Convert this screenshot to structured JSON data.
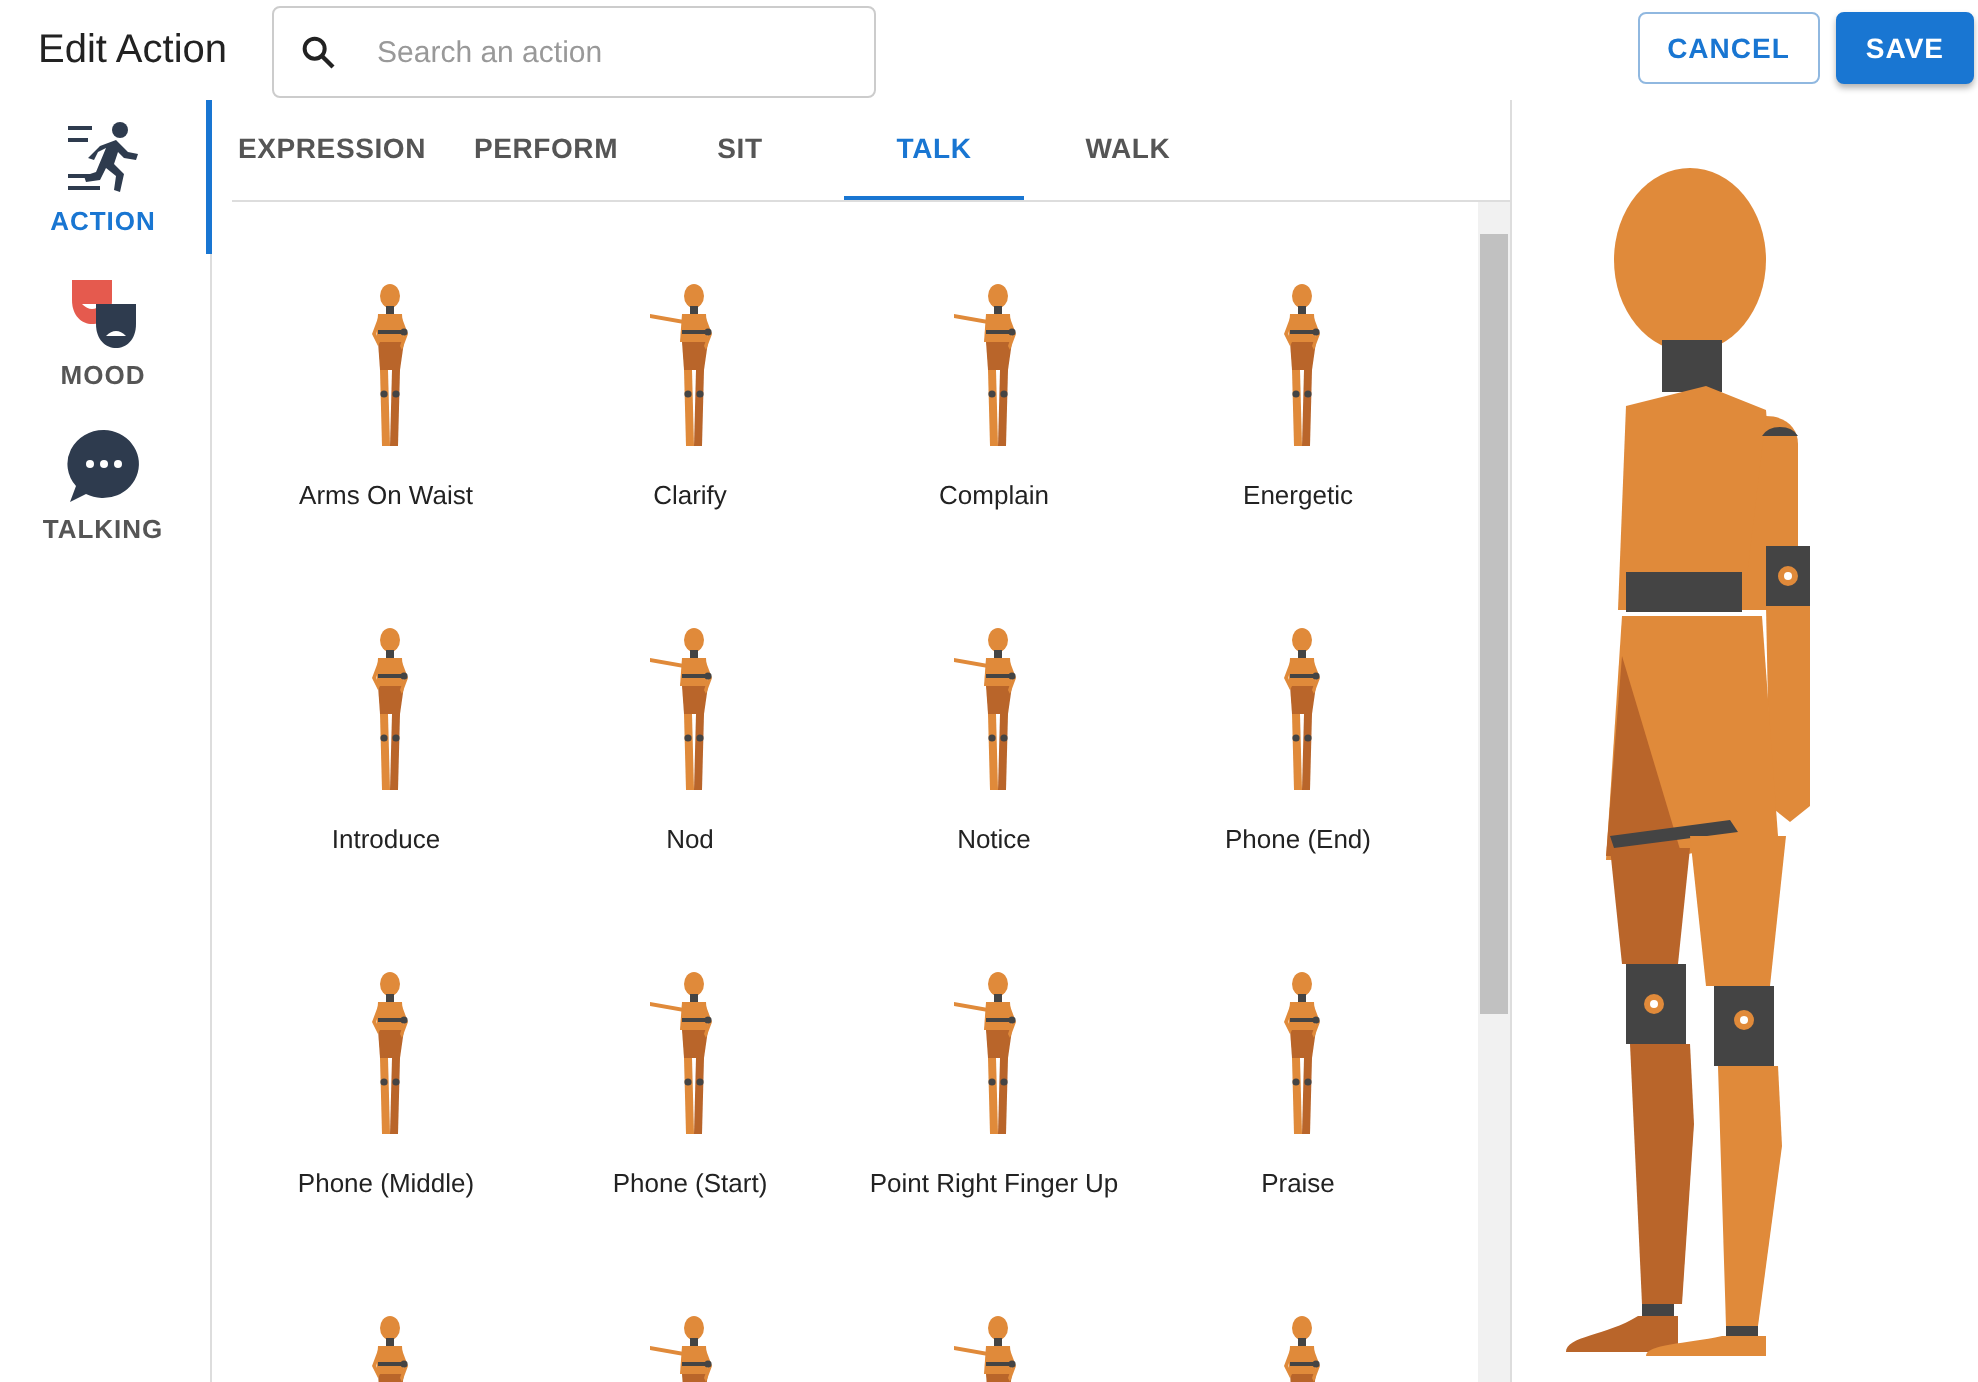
{
  "header": {
    "title": "Edit Action",
    "search": {
      "placeholder": "Search an action"
    },
    "buttons": [
      {
        "label": "CANCEL",
        "kind": "outlined"
      },
      {
        "label": "SAVE",
        "kind": "filled"
      }
    ]
  },
  "sidebar": {
    "items": [
      {
        "label": "ACTION",
        "kind": "action",
        "selected": true
      },
      {
        "label": "MOOD",
        "kind": "mood",
        "selected": false
      },
      {
        "label": "TALKING",
        "kind": "talking",
        "selected": false
      }
    ]
  },
  "tabs": [
    {
      "label": "EXPRESSION",
      "selected": false
    },
    {
      "label": "PERFORM",
      "selected": false
    },
    {
      "label": "SIT",
      "selected": false
    },
    {
      "label": "TALK",
      "selected": true
    },
    {
      "label": "WALK",
      "selected": false
    }
  ],
  "actions": [
    {
      "kind": "labeled",
      "label": "Arms On Waist"
    },
    {
      "kind": "labeled",
      "label": "Clarify"
    },
    {
      "kind": "labeled",
      "label": "Complain"
    },
    {
      "kind": "labeled",
      "label": "Energetic"
    },
    {
      "kind": "labeled",
      "label": "Introduce"
    },
    {
      "kind": "labeled",
      "label": "Nod"
    },
    {
      "kind": "labeled",
      "label": "Notice"
    },
    {
      "kind": "labeled",
      "label": "Phone (End)"
    },
    {
      "kind": "labeled",
      "label": "Phone (Middle)"
    },
    {
      "kind": "labeled",
      "label": "Phone (Start)"
    },
    {
      "kind": "labeled",
      "label": "Point Right Finger Up"
    },
    {
      "kind": "labeled",
      "label": "Praise"
    },
    {
      "kind": "cut_off"
    },
    {
      "kind": "cut_off"
    },
    {
      "kind": "cut_off"
    },
    {
      "kind": "cut_off"
    }
  ]
}
